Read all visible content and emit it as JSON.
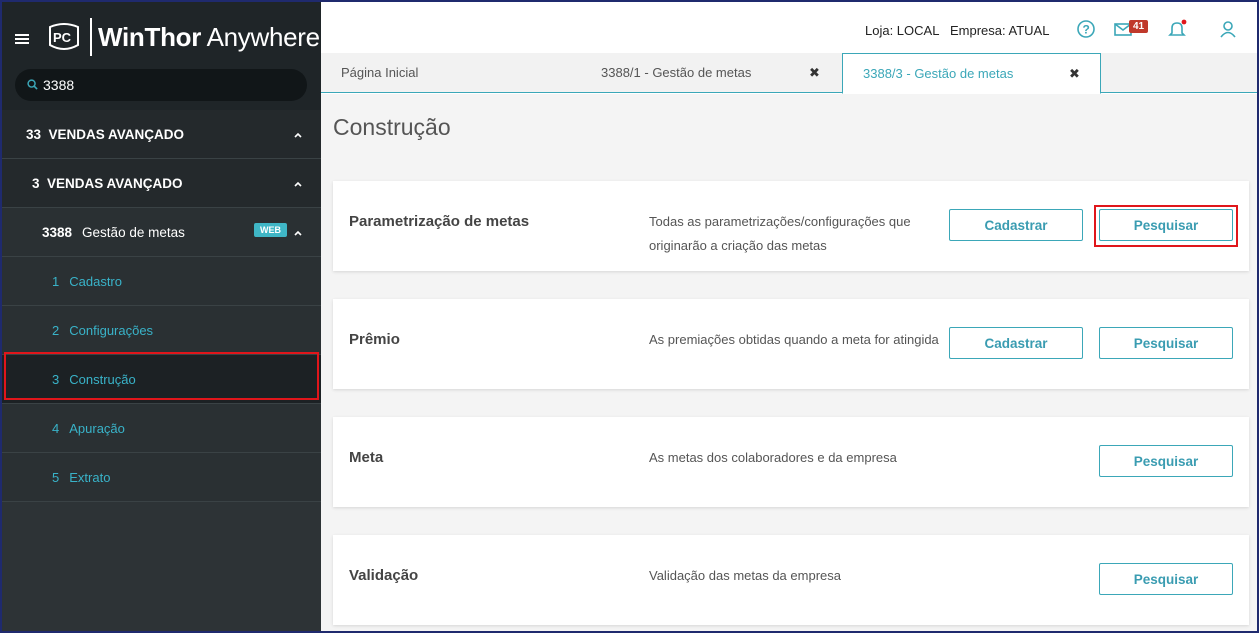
{
  "brand": {
    "name_bold": "WinThor",
    "name_light": " Anywhere",
    "logo_text": "PC"
  },
  "search": {
    "value": "3388"
  },
  "menu": {
    "level1": {
      "num": "33",
      "label": "VENDAS AVANÇADO"
    },
    "level2": {
      "num": "3",
      "label": "VENDAS AVANÇADO"
    },
    "level3": {
      "num": "3388",
      "label": "Gestão de metas",
      "badge": "WEB"
    },
    "items": [
      {
        "num": "1",
        "label": "Cadastro"
      },
      {
        "num": "2",
        "label": "Configurações"
      },
      {
        "num": "3",
        "label": "Construção"
      },
      {
        "num": "4",
        "label": "Apuração"
      },
      {
        "num": "5",
        "label": "Extrato"
      }
    ]
  },
  "topbar": {
    "loja": "Loja: LOCAL",
    "empresa": "Empresa: ATUAL",
    "mail_count": "41"
  },
  "tabs": [
    {
      "label": "Página Inicial"
    },
    {
      "label": "3388/1 - Gestão de metas",
      "close": "✖"
    },
    {
      "label": "3388/3 - Gestão de metas",
      "close": "✖"
    }
  ],
  "page": {
    "title": "Construção"
  },
  "cards": [
    {
      "title": "Parametrização de metas",
      "desc": "Todas as parametrizações/configurações que originarão a criação das metas",
      "cadastrar": "Cadastrar",
      "pesquisar": "Pesquisar"
    },
    {
      "title": "Prêmio",
      "desc": "As premiações obtidas quando a meta for atingida",
      "cadastrar": "Cadastrar",
      "pesquisar": "Pesquisar"
    },
    {
      "title": "Meta",
      "desc": "As metas dos colaboradores e da empresa",
      "pesquisar": "Pesquisar"
    },
    {
      "title": "Validação",
      "desc": "Validação das metas da empresa",
      "pesquisar": "Pesquisar"
    }
  ],
  "colors": {
    "accent": "#3ba7b8",
    "sidebar_bg": "#2d3336",
    "highlight_red": "#e0161b",
    "badge_red": "#c0392b"
  }
}
